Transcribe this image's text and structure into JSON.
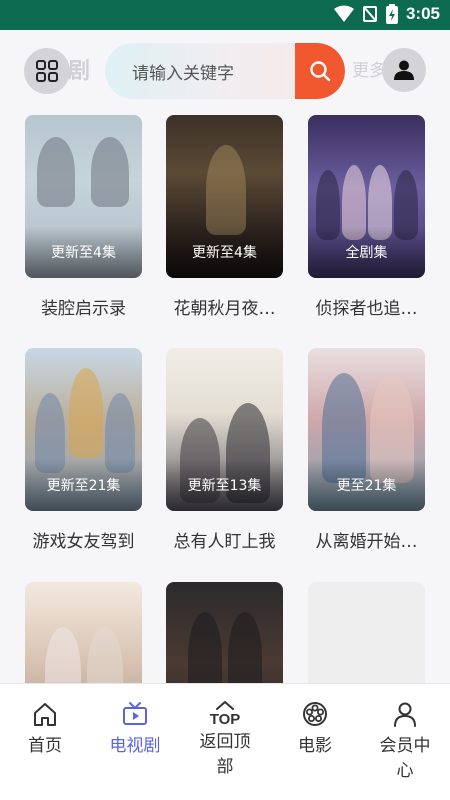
{
  "status_bar": {
    "time": "3:05"
  },
  "header": {
    "faded_title": "剧",
    "faded_more": "更多",
    "search_placeholder": "请输入关键字"
  },
  "shows": [
    {
      "title": "装腔启示录",
      "badge": "更新至4集"
    },
    {
      "title": "花朝秋月夜…",
      "badge": "更新至4集"
    },
    {
      "title": "侦探者也追…",
      "badge": "全剧集"
    },
    {
      "title": "游戏女友驾到",
      "badge": "更新至21集"
    },
    {
      "title": "总有人盯上我",
      "badge": "更新至13集"
    },
    {
      "title": "从离婚开始…",
      "badge": "更至21集"
    },
    {
      "title": "",
      "badge": ""
    },
    {
      "title": "",
      "badge": ""
    },
    {
      "title": "",
      "badge": ""
    }
  ],
  "bottom_nav": {
    "home": "首页",
    "tv": "电视剧",
    "top_glyph": "TOP",
    "back_top": "返回顶部",
    "movie": "电影",
    "member": "会员中心"
  },
  "colors": {
    "status_bar": "#0c6a4e",
    "accent": "#5b63e8",
    "search_button": "#f2582f"
  },
  "icons": {
    "grid": "grid-icon",
    "search": "search-icon",
    "user": "user-icon",
    "home": "home-icon",
    "tv": "tv-icon",
    "top": "chevron-up-icon",
    "movie": "film-reel-icon",
    "member": "person-icon"
  }
}
